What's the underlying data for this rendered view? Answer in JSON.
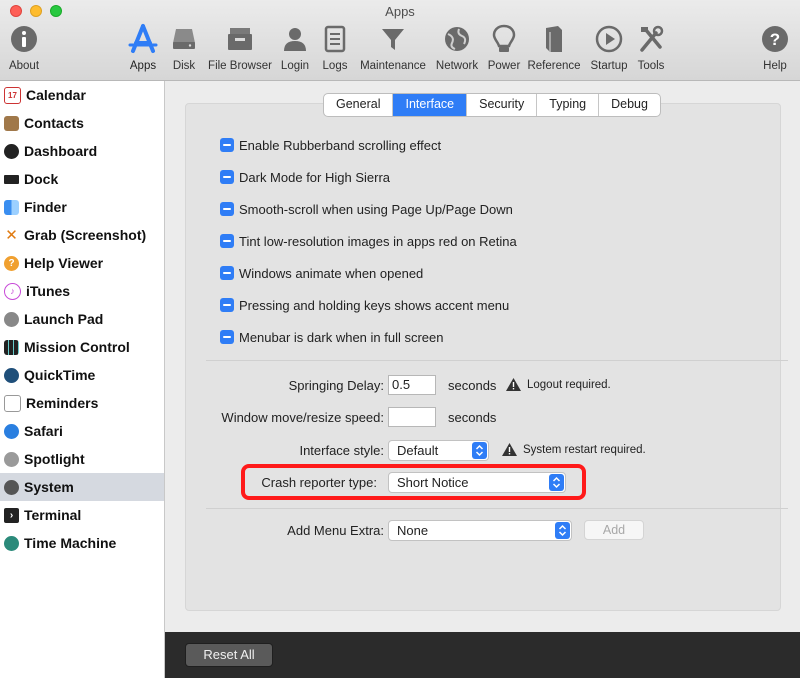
{
  "window": {
    "title": "Apps"
  },
  "toolbar": {
    "about": "About",
    "apps": "Apps",
    "disk": "Disk",
    "file_browser": "File Browser",
    "login": "Login",
    "logs": "Logs",
    "maintenance": "Maintenance",
    "network": "Network",
    "power": "Power",
    "reference": "Reference",
    "startup": "Startup",
    "tools": "Tools",
    "help": "Help"
  },
  "sidebar": {
    "items": [
      {
        "label": "Calendar",
        "icon": "calendar-icon"
      },
      {
        "label": "Contacts",
        "icon": "contacts-icon"
      },
      {
        "label": "Dashboard",
        "icon": "dashboard-icon"
      },
      {
        "label": "Dock",
        "icon": "dock-icon"
      },
      {
        "label": "Finder",
        "icon": "finder-icon"
      },
      {
        "label": "Grab (Screenshot)",
        "icon": "grab-icon"
      },
      {
        "label": "Help Viewer",
        "icon": "help-viewer-icon"
      },
      {
        "label": "iTunes",
        "icon": "itunes-icon"
      },
      {
        "label": "Launch Pad",
        "icon": "launchpad-icon"
      },
      {
        "label": "Mission Control",
        "icon": "mission-control-icon"
      },
      {
        "label": "QuickTime",
        "icon": "quicktime-icon"
      },
      {
        "label": "Reminders",
        "icon": "reminders-icon"
      },
      {
        "label": "Safari",
        "icon": "safari-icon"
      },
      {
        "label": "Spotlight",
        "icon": "spotlight-icon"
      },
      {
        "label": "System",
        "icon": "system-icon",
        "selected": true
      },
      {
        "label": "Terminal",
        "icon": "terminal-icon"
      },
      {
        "label": "Time Machine",
        "icon": "time-machine-icon"
      }
    ]
  },
  "tabs": {
    "general": "General",
    "interface": "Interface",
    "security": "Security",
    "typing": "Typing",
    "debug": "Debug",
    "active": "Interface"
  },
  "options": {
    "rubberband": "Enable Rubberband scrolling effect",
    "dark_mode": "Dark Mode for High Sierra",
    "smooth_scroll": "Smooth-scroll when using Page Up/Page Down",
    "tint": "Tint low-resolution images in apps red on Retina",
    "animate": "Windows animate when opened",
    "accent_menu": "Pressing and holding keys shows accent menu",
    "menubar_dark": "Menubar is dark when in full screen"
  },
  "form": {
    "springing_delay_label": "Springing Delay:",
    "springing_delay_value": "0.5",
    "seconds": "seconds",
    "logout_required": "Logout required.",
    "window_speed_label": "Window move/resize speed:",
    "window_speed_value": "",
    "interface_style_label": "Interface style:",
    "interface_style_value": "Default",
    "restart_required": "System restart required.",
    "crash_reporter_label": "Crash reporter type:",
    "crash_reporter_value": "Short Notice",
    "menu_extra_label": "Add Menu Extra:",
    "menu_extra_value": "None",
    "add_button": "Add"
  },
  "footer": {
    "reset_all": "Reset All"
  },
  "colors": {
    "accent": "#2f7df6",
    "highlight": "#ff1a1a",
    "footer": "#2b2b2b"
  }
}
